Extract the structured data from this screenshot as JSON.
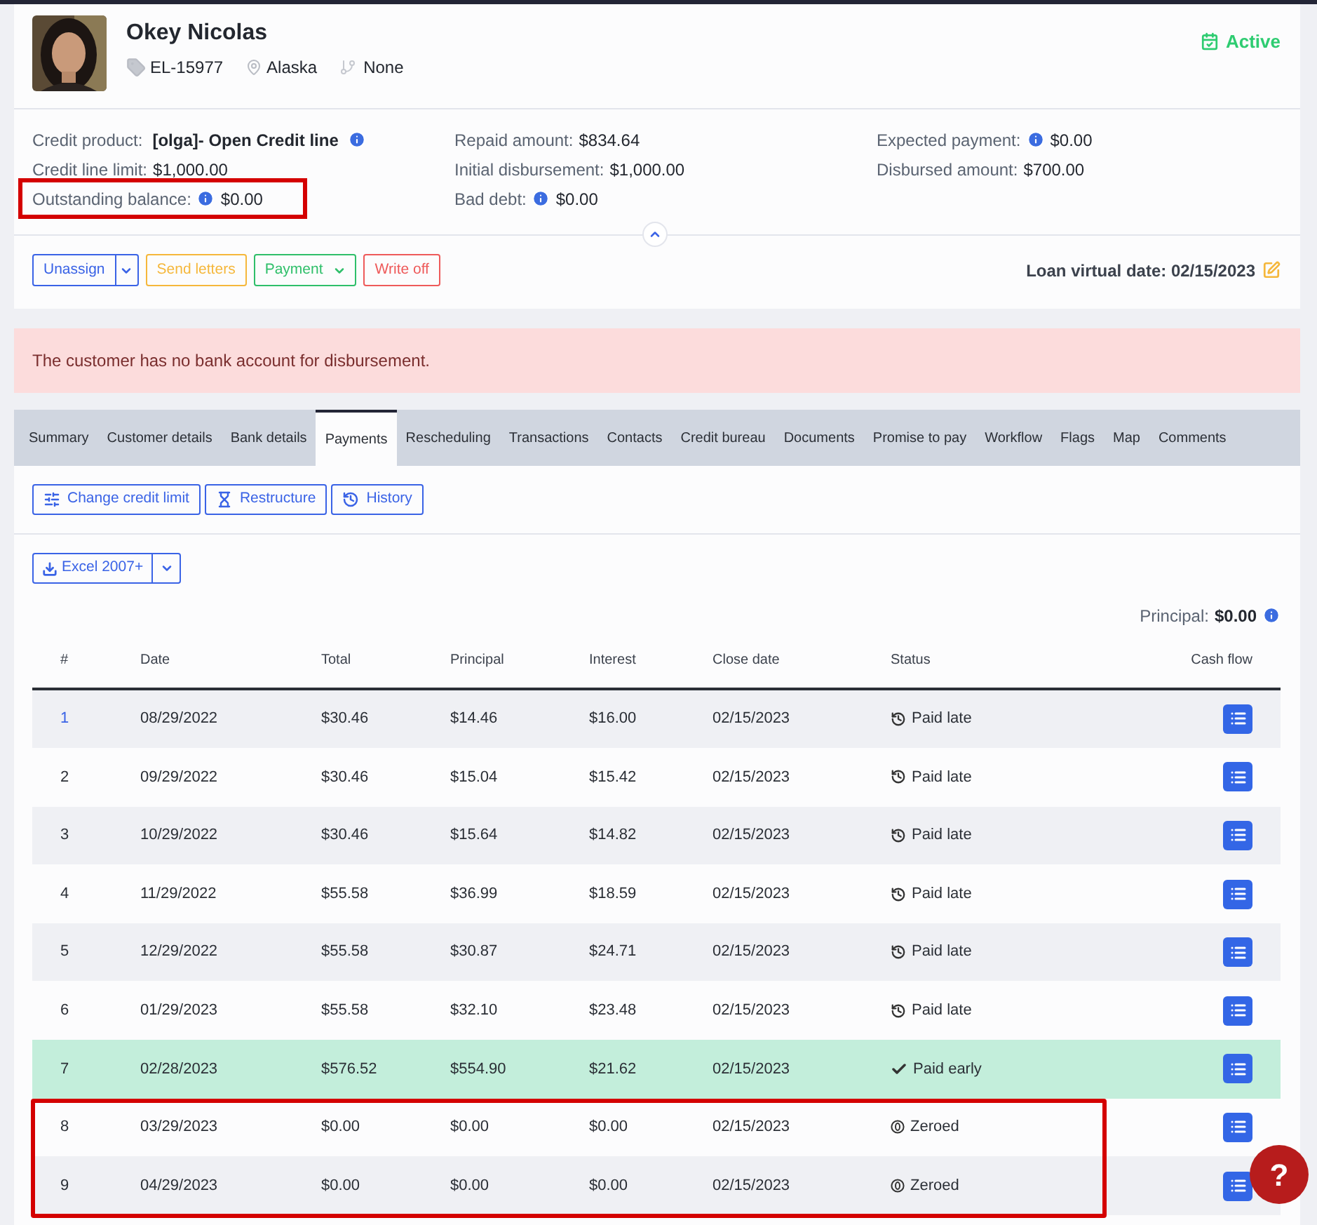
{
  "customer": {
    "name": "Okey Nicolas",
    "id": "EL-15977",
    "location": "Alaska",
    "branch": "None",
    "status": "Active"
  },
  "info_columns": [
    [
      {
        "label": "Credit product:",
        "value": "[olga]- Open Credit line",
        "kind": "info_after",
        "highlighted": false
      },
      {
        "label": "Credit line limit:",
        "value": "$1,000.00",
        "kind": "plain",
        "highlighted": false
      },
      {
        "label": "Outstanding balance:",
        "value": "$0.00",
        "kind": "info_before",
        "highlighted": true
      }
    ],
    [
      {
        "label": "Repaid amount:",
        "value": "$834.64",
        "kind": "plain",
        "highlighted": false
      },
      {
        "label": "Initial disbursement:",
        "value": "$1,000.00",
        "kind": "plain",
        "highlighted": false
      },
      {
        "label": "Bad debt:",
        "value": "$0.00",
        "kind": "info_before",
        "highlighted": false
      }
    ],
    [
      {
        "label": "Expected payment:",
        "value": "$0.00",
        "kind": "info_before",
        "highlighted": false
      },
      {
        "label": "Disbursed amount:",
        "value": "$700.00",
        "kind": "plain",
        "highlighted": false
      }
    ]
  ],
  "actions": [
    {
      "label": "Unassign",
      "color": "#3a63e6",
      "kind": "split"
    },
    {
      "label": "Send letters",
      "color": "#f5b73b",
      "kind": "plain"
    },
    {
      "label": "Payment",
      "color": "#2fbf6a",
      "kind": "menu"
    },
    {
      "label": "Write off",
      "color": "#ee5a5a",
      "kind": "plain"
    }
  ],
  "loan_virtual_date": "Loan virtual date: 02/15/2023",
  "alert": "The customer has no bank account for disbursement.",
  "tabs": [
    {
      "label": "Summary",
      "selected": false
    },
    {
      "label": "Customer details",
      "selected": false
    },
    {
      "label": "Bank details",
      "selected": false
    },
    {
      "label": "Payments",
      "selected": true
    },
    {
      "label": "Rescheduling",
      "selected": false
    },
    {
      "label": "Transactions",
      "selected": false
    },
    {
      "label": "Contacts",
      "selected": false
    },
    {
      "label": "Credit bureau",
      "selected": false
    },
    {
      "label": "Documents",
      "selected": false
    },
    {
      "label": "Promise to pay",
      "selected": false
    },
    {
      "label": "Workflow",
      "selected": false
    },
    {
      "label": "Flags",
      "selected": false
    },
    {
      "label": "Map",
      "selected": false
    },
    {
      "label": "Comments",
      "selected": false
    }
  ],
  "tools": [
    {
      "label": "Change credit limit",
      "kind": "limit"
    },
    {
      "label": "Restructure",
      "kind": "restructure"
    },
    {
      "label": "History",
      "kind": "history"
    }
  ],
  "export": {
    "label": "Excel 2007+"
  },
  "principal": {
    "label": "Principal:",
    "value": "$0.00"
  },
  "table": {
    "columns": [
      "#",
      "Date",
      "Total",
      "Principal",
      "Interest",
      "Close date",
      "Status",
      "Cash flow"
    ],
    "rows": [
      {
        "number": "1",
        "date": "08/29/2022",
        "total": "$30.46",
        "principal": "$14.46",
        "interest": "$16.00",
        "close_date": "02/15/2023",
        "status": "Paid late",
        "kind": "paid_late",
        "highlighted": false
      },
      {
        "number": "2",
        "date": "09/29/2022",
        "total": "$30.46",
        "principal": "$15.04",
        "interest": "$15.42",
        "close_date": "02/15/2023",
        "status": "Paid late",
        "kind": "paid_late",
        "highlighted": false
      },
      {
        "number": "3",
        "date": "10/29/2022",
        "total": "$30.46",
        "principal": "$15.64",
        "interest": "$14.82",
        "close_date": "02/15/2023",
        "status": "Paid late",
        "kind": "paid_late",
        "highlighted": false
      },
      {
        "number": "4",
        "date": "11/29/2022",
        "total": "$55.58",
        "principal": "$36.99",
        "interest": "$18.59",
        "close_date": "02/15/2023",
        "status": "Paid late",
        "kind": "paid_late",
        "highlighted": false
      },
      {
        "number": "5",
        "date": "12/29/2022",
        "total": "$55.58",
        "principal": "$30.87",
        "interest": "$24.71",
        "close_date": "02/15/2023",
        "status": "Paid late",
        "kind": "paid_late",
        "highlighted": false
      },
      {
        "number": "6",
        "date": "01/29/2023",
        "total": "$55.58",
        "principal": "$32.10",
        "interest": "$23.48",
        "close_date": "02/15/2023",
        "status": "Paid late",
        "kind": "paid_late",
        "highlighted": false
      },
      {
        "number": "7",
        "date": "02/28/2023",
        "total": "$576.52",
        "principal": "$554.90",
        "interest": "$21.62",
        "close_date": "02/15/2023",
        "status": "Paid early",
        "kind": "paid_early",
        "highlighted": false
      },
      {
        "number": "8",
        "date": "03/29/2023",
        "total": "$0.00",
        "principal": "$0.00",
        "interest": "$0.00",
        "close_date": "02/15/2023",
        "status": "Zeroed",
        "kind": "zeroed",
        "highlighted": true
      },
      {
        "number": "9",
        "date": "04/29/2023",
        "total": "$0.00",
        "principal": "$0.00",
        "interest": "$0.00",
        "close_date": "02/15/2023",
        "status": "Zeroed",
        "kind": "zeroed",
        "highlighted": true
      }
    ]
  },
  "help": "?"
}
